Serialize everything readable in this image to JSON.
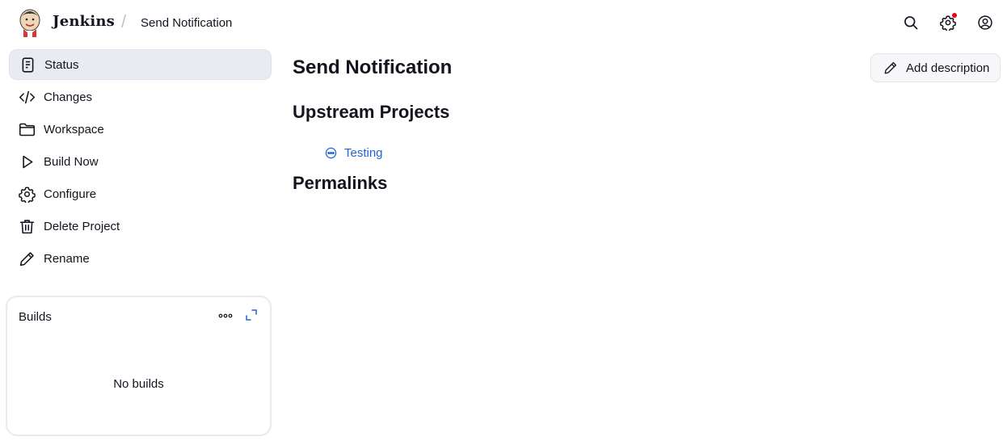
{
  "header": {
    "brand": "Jenkins",
    "breadcrumb_separator": "/",
    "breadcrumb_current": "Send Notification",
    "icons": [
      "search-icon",
      "gear-icon",
      "user-icon"
    ],
    "notification_dot_color": "#e6001f"
  },
  "sidebar": {
    "items": [
      {
        "label": "Status",
        "icon": "status-icon",
        "active": true
      },
      {
        "label": "Changes",
        "icon": "code-icon",
        "active": false
      },
      {
        "label": "Workspace",
        "icon": "folder-icon",
        "active": false
      },
      {
        "label": "Build Now",
        "icon": "play-icon",
        "active": false
      },
      {
        "label": "Configure",
        "icon": "gear-icon",
        "active": false
      },
      {
        "label": "Delete Project",
        "icon": "trash-icon",
        "active": false
      },
      {
        "label": "Rename",
        "icon": "pencil-icon",
        "active": false
      }
    ]
  },
  "builds": {
    "title": "Builds",
    "empty_text": "No builds"
  },
  "main": {
    "title": "Send Notification",
    "add_description_label": "Add description",
    "upstream_heading": "Upstream Projects",
    "upstream_projects": [
      {
        "name": "Testing",
        "status_icon": "not-built-icon"
      }
    ],
    "permalinks_heading": "Permalinks"
  },
  "colors": {
    "link": "#1f63d3",
    "active_bg": "#e9ebf2"
  }
}
